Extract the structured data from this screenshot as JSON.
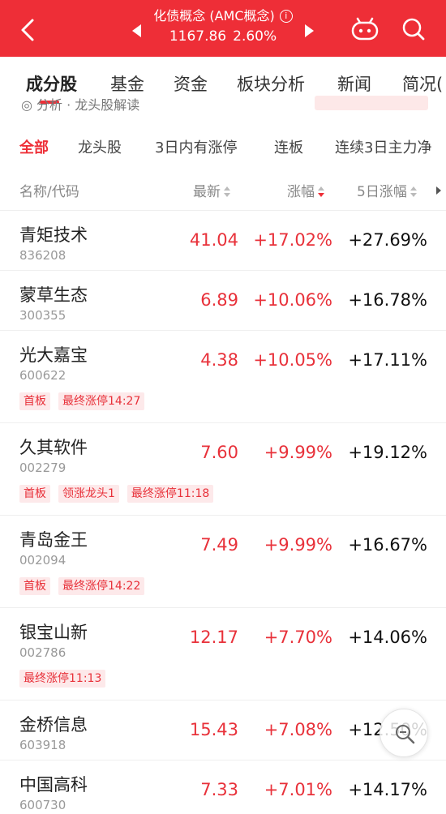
{
  "header": {
    "title": "化债概念 (AMC概念)",
    "info_glyph": "i",
    "price": "1167.86",
    "change_pct": "2.60%",
    "brand_color": "#ee2e37"
  },
  "main_tabs": [
    "成分股",
    "基金",
    "资金",
    "板块分析",
    "新闻",
    "简况("
  ],
  "partial_strip": "◎ 分析 · 龙头股解读",
  "sub_tabs": [
    "全部",
    "龙头股",
    "3日内有涨停",
    "连板",
    "连续3日主力净"
  ],
  "columns": {
    "name": "名称/代码",
    "latest": "最新",
    "change": "涨幅",
    "five_day": "5日涨幅"
  },
  "rows": [
    {
      "name": "青矩技术",
      "code": "836208",
      "price": "41.04",
      "change": "+17.02%",
      "five_day": "+27.69%",
      "badges": []
    },
    {
      "name": "蒙草生态",
      "code": "300355",
      "price": "6.89",
      "change": "+10.06%",
      "five_day": "+16.78%",
      "badges": []
    },
    {
      "name": "光大嘉宝",
      "code": "600622",
      "price": "4.38",
      "change": "+10.05%",
      "five_day": "+17.11%",
      "badges": [
        "首板",
        "最终涨停14:27"
      ]
    },
    {
      "name": "久其软件",
      "code": "002279",
      "price": "7.60",
      "change": "+9.99%",
      "five_day": "+19.12%",
      "badges": [
        "首板",
        "领涨龙头1",
        "最终涨停11:18"
      ]
    },
    {
      "name": "青岛金王",
      "code": "002094",
      "price": "7.49",
      "change": "+9.99%",
      "five_day": "+16.67%",
      "badges": [
        "首板",
        "最终涨停14:22"
      ]
    },
    {
      "name": "银宝山新",
      "code": "002786",
      "price": "12.17",
      "change": "+7.70%",
      "five_day": "+14.06%",
      "badges": [
        "最终涨停11:13"
      ]
    },
    {
      "name": "金桥信息",
      "code": "603918",
      "price": "15.43",
      "change": "+7.08%",
      "five_day": "+12.50%",
      "badges": []
    },
    {
      "name": "中国高科",
      "code": "600730",
      "price": "7.33",
      "change": "+7.01%",
      "five_day": "+14.17%",
      "badges": []
    }
  ],
  "icons": [
    "back-icon",
    "prev-arrow-icon",
    "next-arrow-icon",
    "robot-icon",
    "search-icon",
    "info-icon",
    "sort-icon",
    "zoom-icon"
  ]
}
